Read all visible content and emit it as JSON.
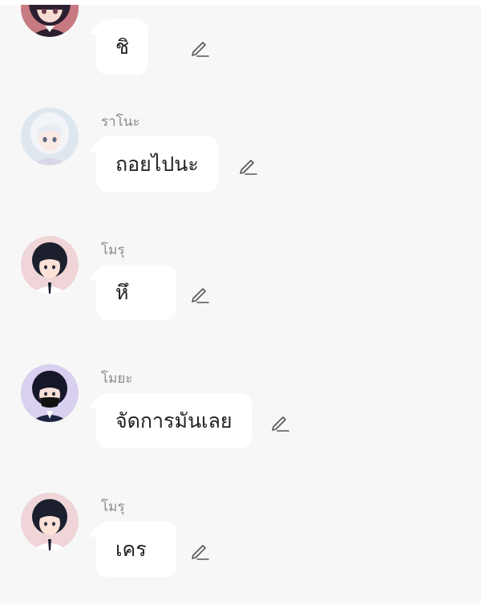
{
  "messages": [
    {
      "sender": "",
      "text": "ชิ",
      "avatar": "girl-dark-hair-avatar",
      "edit_icon": "pencil-icon"
    },
    {
      "sender": "ราโนะ",
      "text": "ถอยไปนะ",
      "avatar": "girl-white-hair-avatar",
      "edit_icon": "pencil-icon"
    },
    {
      "sender": "โมรุ",
      "text": "หึ",
      "avatar": "boy-black-hair-tie-avatar",
      "edit_icon": "pencil-icon"
    },
    {
      "sender": "โมยะ",
      "text": "จัดการมันเลย",
      "avatar": "boy-black-mask-avatar",
      "edit_icon": "pencil-icon"
    },
    {
      "sender": "โมรุ",
      "text": "เคร",
      "avatar": "boy-black-hair-tie-avatar",
      "edit_icon": "pencil-icon"
    }
  ],
  "colors": {
    "background": "#f7f7f7",
    "bubble": "#ffffff",
    "sender_text": "#8a8a8a",
    "message_text": "#222222"
  }
}
